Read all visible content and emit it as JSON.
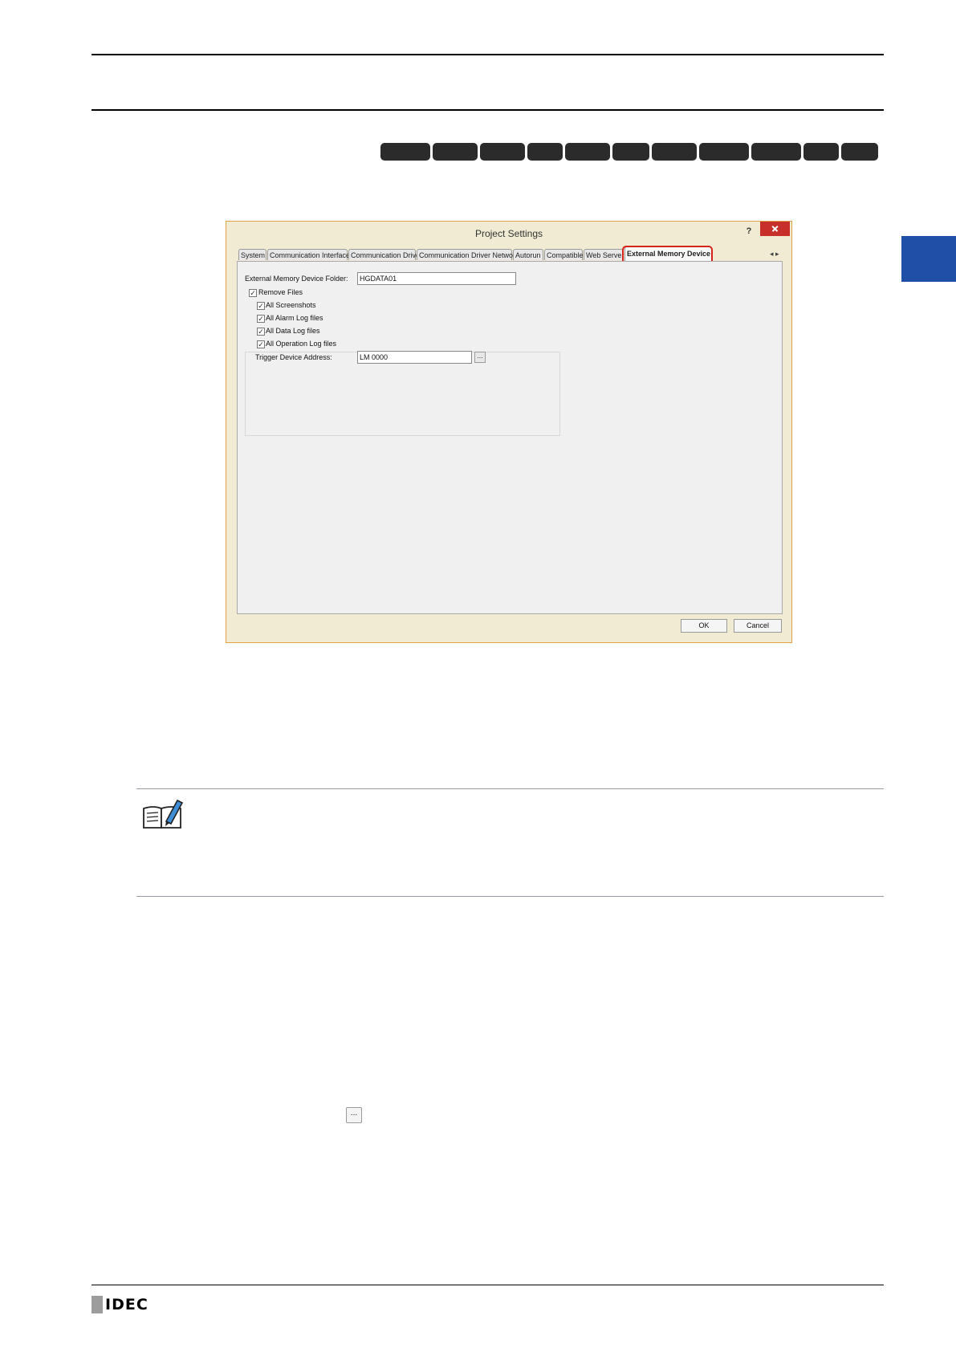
{
  "page": {
    "accent_color": "#1f4fa6",
    "footer_logo": "IDEC"
  },
  "model_tags": [
    {
      "label": ""
    },
    {
      "label": ""
    },
    {
      "label": ""
    },
    {
      "label": ""
    },
    {
      "label": ""
    },
    {
      "label": ""
    },
    {
      "label": ""
    },
    {
      "label": ""
    },
    {
      "label": ""
    },
    {
      "label": ""
    },
    {
      "label": ""
    }
  ],
  "dialog": {
    "title": "Project Settings",
    "help_label": "?",
    "close_icon": "close-icon",
    "tabs": [
      {
        "label": "System"
      },
      {
        "label": "Communication Interface"
      },
      {
        "label": "Communication Driver"
      },
      {
        "label": "Communication Driver Network"
      },
      {
        "label": "Autorun"
      },
      {
        "label": "Compatible"
      },
      {
        "label": "Web Server"
      },
      {
        "label": "External Memory Device"
      }
    ],
    "tab_scroll_arrows": "◂ ▸",
    "folder_label": "External Memory Device Folder:",
    "folder_value": "HGDATA01",
    "remove_files_label": "Remove Files",
    "checkboxes": [
      {
        "label": "All Screenshots",
        "checked": true
      },
      {
        "label": "All Alarm Log files",
        "checked": true
      },
      {
        "label": "All Data Log files",
        "checked": true
      },
      {
        "label": "All Operation Log files",
        "checked": true
      }
    ],
    "trigger_label": "Trigger Device Address:",
    "trigger_value": "LM 0000",
    "browse_label": "...",
    "ok_label": "OK",
    "cancel_label": "Cancel"
  },
  "inline_browse_label": "..."
}
